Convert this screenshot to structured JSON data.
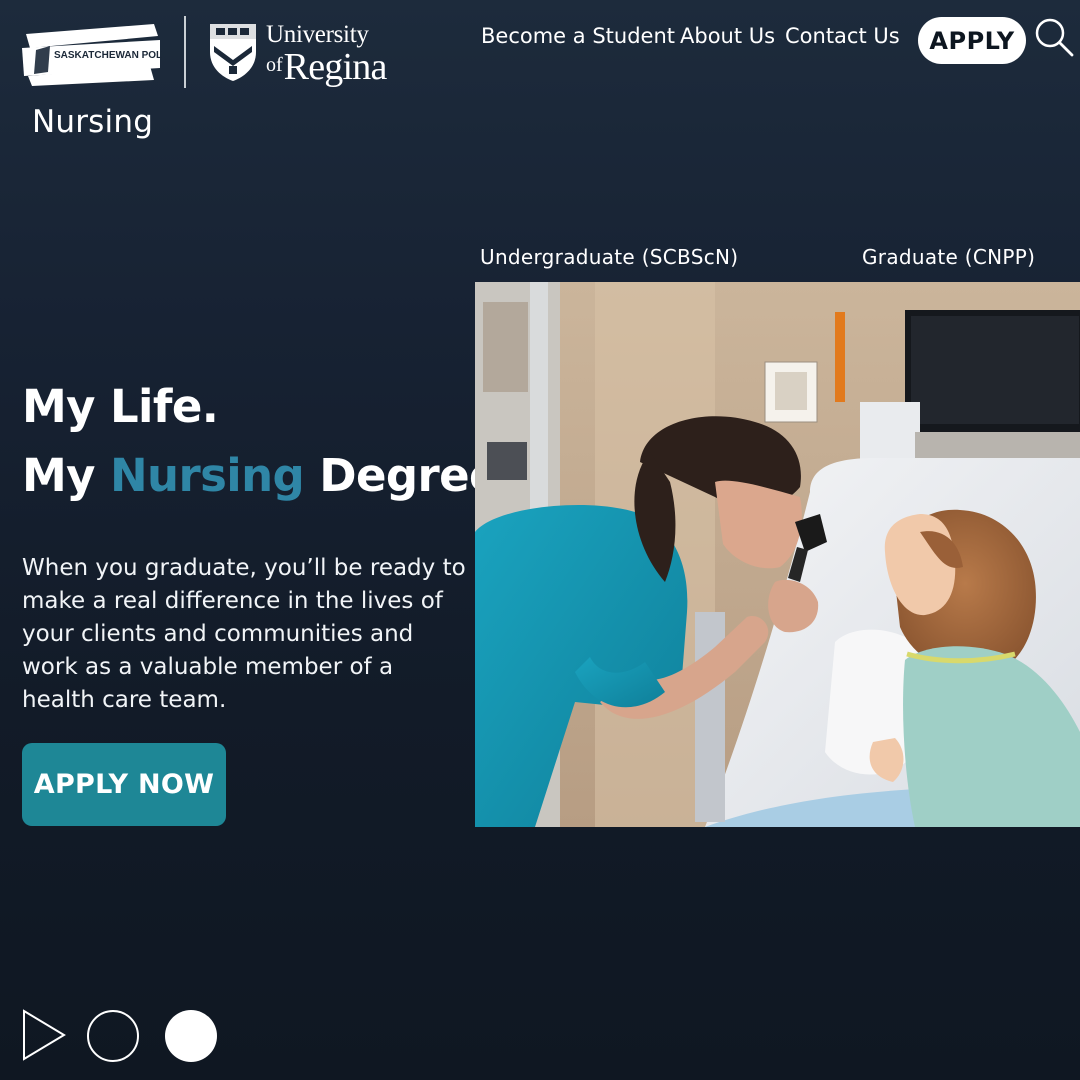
{
  "header": {
    "logo_sask_poly": "SASKATCHEWAN POLYTECHNIC",
    "logo_uofr_line1": "University",
    "logo_uofr_of": "of",
    "logo_uofr_regina": "Regina",
    "program_title": "Nursing",
    "nav": [
      "Become a Student",
      "About Us",
      "Contact Us"
    ],
    "apply_label": "APPLY",
    "search_icon": "search-icon"
  },
  "tabs": [
    "Undergraduate (SCBScN)",
    "Graduate (CNPP)"
  ],
  "hero": {
    "headline_line1": "My Life.",
    "headline_line2_pre": "My ",
    "headline_line2_accent": "Nursing",
    "headline_line2_post": " Degree.",
    "body": "When you graduate, you’ll be ready to make a real difference in the lives of your clients and communities and work as a valuable member of a health care team.",
    "cta_label": "APPLY NOW",
    "image_description_icon": "photo-nurse-child"
  },
  "carousel": {
    "play_icon": "play-icon",
    "dots": 2,
    "active_dot": 2
  },
  "colors": {
    "background_top": "#1d2b3c",
    "background_bottom": "#0f1722",
    "accent_text": "#2f86a6",
    "cta_button": "#1e8796",
    "apply_pill": "#ffffff"
  }
}
